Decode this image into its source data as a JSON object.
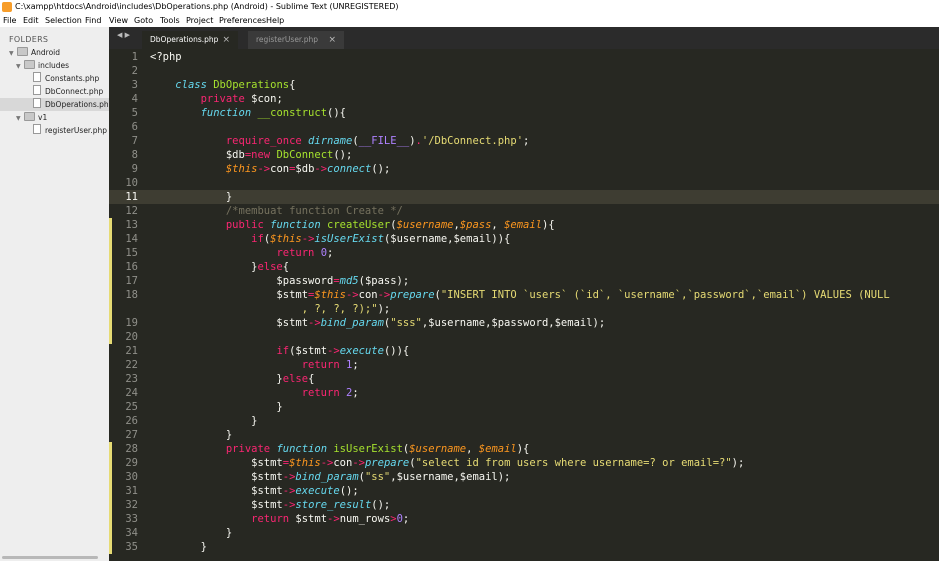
{
  "window": {
    "title": "C:\\xampp\\htdocs\\Android\\includes\\DbOperations.php (Android) - Sublime Text (UNREGISTERED)"
  },
  "menu": [
    "File",
    "Edit",
    "Selection",
    "Find",
    "View",
    "Goto",
    "Tools",
    "Project",
    "Preferences",
    "Help"
  ],
  "sidebar": {
    "heading": "FOLDERS",
    "items": [
      {
        "label": "Android",
        "type": "folder",
        "expanded": true
      },
      {
        "label": "includes",
        "type": "folder",
        "expanded": true
      },
      {
        "label": "Constants.php",
        "type": "file"
      },
      {
        "label": "DbConnect.php",
        "type": "file"
      },
      {
        "label": "DbOperations.php",
        "type": "file",
        "selected": true
      },
      {
        "label": "v1",
        "type": "folder",
        "expanded": true
      },
      {
        "label": "registerUser.php",
        "type": "file"
      }
    ]
  },
  "tabs": [
    {
      "label": "DbOperations.php",
      "active": true
    },
    {
      "label": "registerUser.php",
      "active": false
    }
  ],
  "tab_close_glyph": "×",
  "nav_arrows": "◀ ▶",
  "colors": {
    "editor_bg": "#272822",
    "keyword": "#f92672",
    "storage": "#66d9ef",
    "function": "#a6e22e",
    "string": "#e6db74",
    "number": "#ae81ff",
    "comment": "#75715e",
    "param": "#fd971f",
    "text": "#f8f8f2"
  },
  "editor": {
    "current_line": 11,
    "line_numbers": [
      "1",
      "2",
      "3",
      "4",
      "5",
      "6",
      "7",
      "8",
      "9",
      "10",
      "11",
      "12",
      "13",
      "14",
      "15",
      "16",
      "17",
      "18",
      "",
      "19",
      "20",
      "21",
      "22",
      "23",
      "24",
      "25",
      "26",
      "27",
      "28",
      "29",
      "30",
      "31",
      "32",
      "33",
      "34",
      "35"
    ],
    "lines": [
      [
        [
          "t",
          "<?php"
        ]
      ],
      [],
      [
        [
          "t",
          "    "
        ],
        [
          "s",
          "class"
        ],
        [
          "t",
          " "
        ],
        [
          "f",
          "DbOperations"
        ],
        [
          "t",
          "{"
        ]
      ],
      [
        [
          "t",
          "        "
        ],
        [
          "k",
          "private"
        ],
        [
          "t",
          " $con;"
        ]
      ],
      [
        [
          "t",
          "        "
        ],
        [
          "s",
          "function"
        ],
        [
          "t",
          " "
        ],
        [
          "f",
          "__construct"
        ],
        [
          "t",
          "(){"
        ]
      ],
      [],
      [
        [
          "t",
          "            "
        ],
        [
          "k",
          "require_once"
        ],
        [
          "t",
          " "
        ],
        [
          "s",
          "dirname"
        ],
        [
          "t",
          "("
        ],
        [
          "n",
          "__FILE__"
        ],
        [
          "t",
          ")"
        ],
        [
          "k",
          "."
        ],
        [
          "y",
          "'/DbConnect.php'"
        ],
        [
          "t",
          ";"
        ]
      ],
      [
        [
          "t",
          "            $db"
        ],
        [
          "k",
          "="
        ],
        [
          "k",
          "new"
        ],
        [
          "t",
          " "
        ],
        [
          "f",
          "DbConnect"
        ],
        [
          "t",
          "();"
        ]
      ],
      [
        [
          "t",
          "            "
        ],
        [
          "p",
          "$this"
        ],
        [
          "k",
          "->"
        ],
        [
          "t",
          "con"
        ],
        [
          "k",
          "="
        ],
        [
          "t",
          "$db"
        ],
        [
          "k",
          "->"
        ],
        [
          "s",
          "connect"
        ],
        [
          "t",
          "();"
        ]
      ],
      [],
      [
        [
          "t",
          "            }"
        ]
      ],
      [
        [
          "c",
          "            /*membuat function Create */"
        ]
      ],
      [
        [
          "t",
          "            "
        ],
        [
          "k",
          "public"
        ],
        [
          "t",
          " "
        ],
        [
          "s",
          "function"
        ],
        [
          "t",
          " "
        ],
        [
          "f",
          "createUser"
        ],
        [
          "t",
          "("
        ],
        [
          "p",
          "$username"
        ],
        [
          "t",
          ","
        ],
        [
          "p",
          "$pass"
        ],
        [
          "t",
          ", "
        ],
        [
          "p",
          "$email"
        ],
        [
          "t",
          "){"
        ]
      ],
      [
        [
          "t",
          "                "
        ],
        [
          "k",
          "if"
        ],
        [
          "t",
          "("
        ],
        [
          "p",
          "$this"
        ],
        [
          "k",
          "->"
        ],
        [
          "s",
          "isUserExist"
        ],
        [
          "t",
          "($username,$email)){"
        ]
      ],
      [
        [
          "t",
          "                    "
        ],
        [
          "k",
          "return"
        ],
        [
          "t",
          " "
        ],
        [
          "n",
          "0"
        ],
        [
          "t",
          ";"
        ]
      ],
      [
        [
          "t",
          "                }"
        ],
        [
          "k",
          "else"
        ],
        [
          "t",
          "{"
        ]
      ],
      [
        [
          "t",
          "                    $password"
        ],
        [
          "k",
          "="
        ],
        [
          "s",
          "md5"
        ],
        [
          "t",
          "($pass);"
        ]
      ],
      [
        [
          "t",
          "                    $stmt"
        ],
        [
          "k",
          "="
        ],
        [
          "p",
          "$this"
        ],
        [
          "k",
          "->"
        ],
        [
          "t",
          "con"
        ],
        [
          "k",
          "->"
        ],
        [
          "s",
          "prepare"
        ],
        [
          "t",
          "("
        ],
        [
          "y",
          "\"INSERT INTO `users` (`id`, `username`,`password`,`email`) VALUES (NULL"
        ]
      ],
      [
        [
          "y",
          "                        , ?, ?, ?);\""
        ],
        [
          "t",
          ");"
        ]
      ],
      [
        [
          "t",
          "                    $stmt"
        ],
        [
          "k",
          "->"
        ],
        [
          "s",
          "bind_param"
        ],
        [
          "t",
          "("
        ],
        [
          "y",
          "\"sss\""
        ],
        [
          "t",
          ",$username,$password,$email);"
        ]
      ],
      [],
      [
        [
          "t",
          "                    "
        ],
        [
          "k",
          "if"
        ],
        [
          "t",
          "($stmt"
        ],
        [
          "k",
          "->"
        ],
        [
          "s",
          "execute"
        ],
        [
          "t",
          "()){"
        ]
      ],
      [
        [
          "t",
          "                        "
        ],
        [
          "k",
          "return"
        ],
        [
          "t",
          " "
        ],
        [
          "n",
          "1"
        ],
        [
          "t",
          ";"
        ]
      ],
      [
        [
          "t",
          "                    }"
        ],
        [
          "k",
          "else"
        ],
        [
          "t",
          "{"
        ]
      ],
      [
        [
          "t",
          "                        "
        ],
        [
          "k",
          "return"
        ],
        [
          "t",
          " "
        ],
        [
          "n",
          "2"
        ],
        [
          "t",
          ";"
        ]
      ],
      [
        [
          "t",
          "                    }"
        ]
      ],
      [
        [
          "t",
          "                }"
        ]
      ],
      [
        [
          "t",
          "            }"
        ]
      ],
      [
        [
          "t",
          "            "
        ],
        [
          "k",
          "private"
        ],
        [
          "t",
          " "
        ],
        [
          "s",
          "function"
        ],
        [
          "t",
          " "
        ],
        [
          "f",
          "isUserExist"
        ],
        [
          "t",
          "("
        ],
        [
          "p",
          "$username"
        ],
        [
          "t",
          ", "
        ],
        [
          "p",
          "$email"
        ],
        [
          "t",
          "){"
        ]
      ],
      [
        [
          "t",
          "                $stmt"
        ],
        [
          "k",
          "="
        ],
        [
          "p",
          "$this"
        ],
        [
          "k",
          "->"
        ],
        [
          "t",
          "con"
        ],
        [
          "k",
          "->"
        ],
        [
          "s",
          "prepare"
        ],
        [
          "t",
          "("
        ],
        [
          "y",
          "\"select id from users where username=? or email=?\""
        ],
        [
          "t",
          ");"
        ]
      ],
      [
        [
          "t",
          "                $stmt"
        ],
        [
          "k",
          "->"
        ],
        [
          "s",
          "bind_param"
        ],
        [
          "t",
          "("
        ],
        [
          "y",
          "\"ss\""
        ],
        [
          "t",
          ",$username,$email);"
        ]
      ],
      [
        [
          "t",
          "                $stmt"
        ],
        [
          "k",
          "->"
        ],
        [
          "s",
          "execute"
        ],
        [
          "t",
          "();"
        ]
      ],
      [
        [
          "t",
          "                $stmt"
        ],
        [
          "k",
          "->"
        ],
        [
          "s",
          "store_result"
        ],
        [
          "t",
          "();"
        ]
      ],
      [
        [
          "t",
          "                "
        ],
        [
          "k",
          "return"
        ],
        [
          "t",
          " $stmt"
        ],
        [
          "k",
          "->"
        ],
        [
          "t",
          "num_rows"
        ],
        [
          "k",
          ">"
        ],
        [
          "n",
          "0"
        ],
        [
          "t",
          ";"
        ]
      ],
      [
        [
          "t",
          "            }"
        ]
      ],
      [
        [
          "t",
          "        }"
        ]
      ]
    ]
  }
}
